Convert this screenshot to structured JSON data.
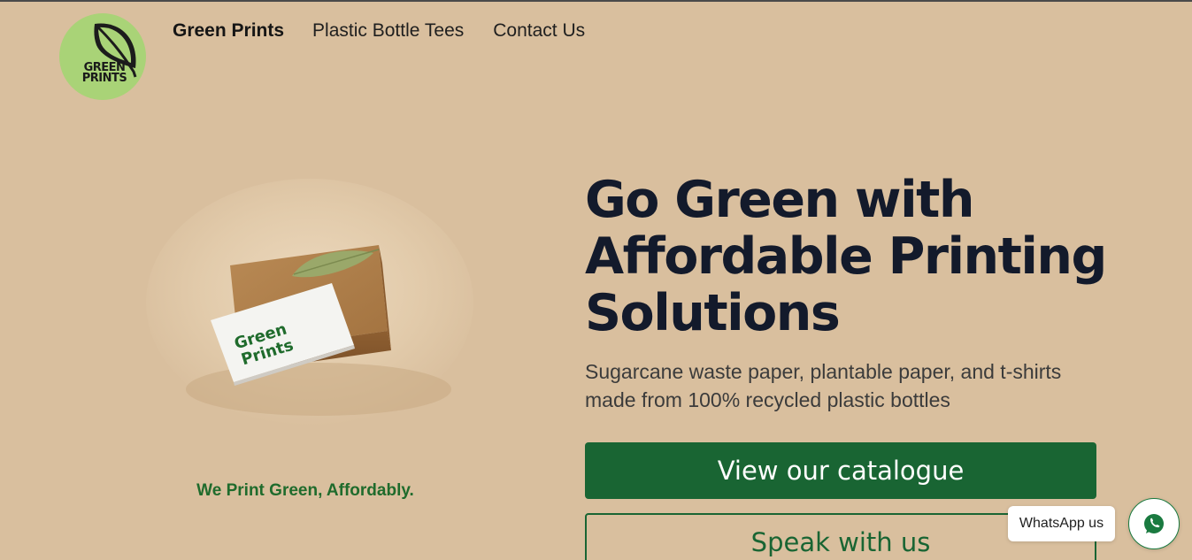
{
  "header": {
    "logo": {
      "line1": "GREEN",
      "line2": "PRINTS",
      "icon": "leaf-icon"
    },
    "nav": [
      {
        "label": "Green Prints",
        "active": true
      },
      {
        "label": "Plastic Bottle Tees",
        "active": false
      },
      {
        "label": "Contact Us",
        "active": false
      }
    ]
  },
  "hero": {
    "image": {
      "card_line1": "Green",
      "card_line2": "Prints"
    },
    "tagline": "We Print Green, Affordably.",
    "headline": "Go Green with Affordable Printing Solutions",
    "subtext": "Sugarcane waste paper, plantable paper, and t-shirts made from 100% recycled plastic bottles",
    "primary_button": "View our catalogue",
    "secondary_button": "Speak with us"
  },
  "whatsapp": {
    "label": "WhatsApp us",
    "icon": "whatsapp-icon"
  },
  "colors": {
    "background": "#d9bf9e",
    "brand_green": "#196533",
    "logo_green": "#a9d377",
    "headline": "#131a2b"
  }
}
